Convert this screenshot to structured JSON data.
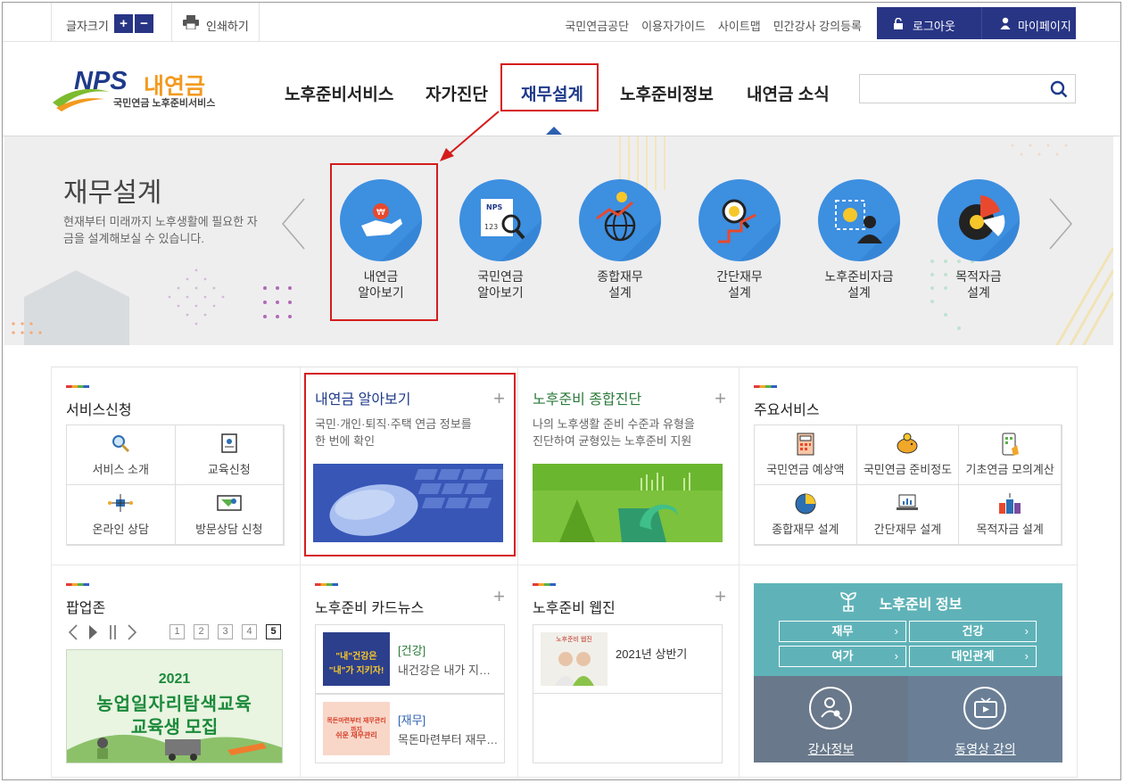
{
  "util": {
    "font_size_label": "글자크기",
    "font_plus": "+",
    "font_minus": "−",
    "print_label": "인쇄하기",
    "links": [
      "국민연금공단",
      "이용자가이드",
      "사이트맵",
      "민간강사 강의등록"
    ],
    "logout_label": "로그아웃",
    "mypage_label": "마이페이지"
  },
  "logo": {
    "brand": "NPS",
    "name": "내연금",
    "sub": "국민연금 노후준비서비스"
  },
  "nav": [
    "노후준비서비스",
    "자가진단",
    "재무설계",
    "노후준비정보",
    "내연금 소식"
  ],
  "nav_active": "재무설계",
  "banner": {
    "title": "재무설계",
    "desc": "현재부터 미래까지 노후생활에 필요한 자금을 설계해보실 수 있습니다.",
    "items": [
      {
        "line1": "내연금",
        "line2": "알아보기",
        "icon": "hand-coin-icon"
      },
      {
        "line1": "국민연금",
        "line2": "알아보기",
        "icon": "nps-magnifier-icon"
      },
      {
        "line1": "종합재무",
        "line2": "설계",
        "icon": "globe-chart-icon"
      },
      {
        "line1": "간단재무",
        "line2": "설계",
        "icon": "magnifier-chart-icon"
      },
      {
        "line1": "노후준비자금",
        "line2": "설계",
        "icon": "person-coin-icon"
      },
      {
        "line1": "목적자금",
        "line2": "설계",
        "icon": "pie-coin-icon"
      }
    ]
  },
  "service_apply": {
    "title_a": "서비스",
    "title_b": "신청",
    "items": [
      "서비스 소개",
      "교육신청",
      "온라인 상담",
      "방문상담 신청"
    ]
  },
  "card1": {
    "title": "내연금 알아보기",
    "desc1": "국민·개인·퇴직·주택 연금 정보를",
    "desc2": "한 번에 확인"
  },
  "card2": {
    "title_a": "노후준비",
    "title_b": " 종합진단",
    "desc1": "나의 노후생활 준비 수준과 유형을",
    "desc2": "진단하여 균형있는 노후준비 지원"
  },
  "main_services": {
    "title_a": "주요",
    "title_b": "서비스",
    "items": [
      "국민연금 예상액",
      "국민연금 준비정도",
      "기초연금 모의계산",
      "종합재무 설계",
      "간단재무 설계",
      "목적자금 설계"
    ]
  },
  "popup": {
    "title_a": "팝업",
    "title_b": "존",
    "pages": [
      "1",
      "2",
      "3",
      "4",
      "5"
    ],
    "current": "5",
    "banner_year": "2021",
    "banner_line1": "농업일자리탐색교육",
    "banner_line2": "교육생 모집"
  },
  "cardnews": {
    "title_a": "노후준비 ",
    "title_b": "카드뉴스",
    "items": [
      {
        "cat": "[건강]",
        "text": "내건강은 내가 지…",
        "thumb1": "\"내\"건강은",
        "thumb2": "\"내\"가 지키자!"
      },
      {
        "cat": "[재무]",
        "text": "목돈마련부터 재무…",
        "thumb1": "목돈마련부터 재무관리까지",
        "thumb2": "쉬운 재무관리"
      }
    ]
  },
  "webzine": {
    "title_a": "노후준비 ",
    "title_b": "웹진",
    "item": "2021년 상반기",
    "thumb_label": "노후준비 웹진"
  },
  "info": {
    "title": "노후준비 정보",
    "buttons": [
      "재무",
      "건강",
      "여가",
      "대인관계"
    ],
    "bottom": [
      "강사정보",
      "동영상 강의"
    ]
  }
}
